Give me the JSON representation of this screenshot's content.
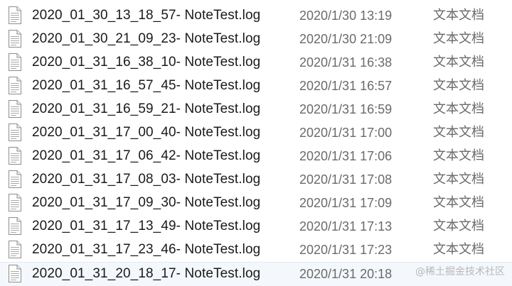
{
  "files": [
    {
      "name": "2020_01_30_13_18_57- NoteTest.log",
      "modified": "2020/1/30 13:19",
      "type": "文本文档"
    },
    {
      "name": "2020_01_30_21_09_23- NoteTest.log",
      "modified": "2020/1/30 21:09",
      "type": "文本文档"
    },
    {
      "name": "2020_01_31_16_38_10- NoteTest.log",
      "modified": "2020/1/31 16:38",
      "type": "文本文档"
    },
    {
      "name": "2020_01_31_16_57_45- NoteTest.log",
      "modified": "2020/1/31 16:57",
      "type": "文本文档"
    },
    {
      "name": "2020_01_31_16_59_21- NoteTest.log",
      "modified": "2020/1/31 16:59",
      "type": "文本文档"
    },
    {
      "name": "2020_01_31_17_00_40- NoteTest.log",
      "modified": "2020/1/31 17:00",
      "type": "文本文档"
    },
    {
      "name": "2020_01_31_17_06_42- NoteTest.log",
      "modified": "2020/1/31 17:06",
      "type": "文本文档"
    },
    {
      "name": "2020_01_31_17_08_03- NoteTest.log",
      "modified": "2020/1/31 17:08",
      "type": "文本文档"
    },
    {
      "name": "2020_01_31_17_09_30- NoteTest.log",
      "modified": "2020/1/31 17:09",
      "type": "文本文档"
    },
    {
      "name": "2020_01_31_17_13_49- NoteTest.log",
      "modified": "2020/1/31 17:13",
      "type": "文本文档"
    },
    {
      "name": "2020_01_31_17_23_46- NoteTest.log",
      "modified": "2020/1/31 17:23",
      "type": "文本文档"
    },
    {
      "name": "2020_01_31_20_18_17- NoteTest.log",
      "modified": "2020/1/31 20:18",
      "type": "文本文档"
    }
  ],
  "watermark": "@稀土掘金技术社区",
  "icon": "text-document-icon",
  "colors": {
    "name_text": "#1a1a1a",
    "meta_text": "#6a6a6a",
    "selected_row_bg": "#f4f8fc"
  }
}
